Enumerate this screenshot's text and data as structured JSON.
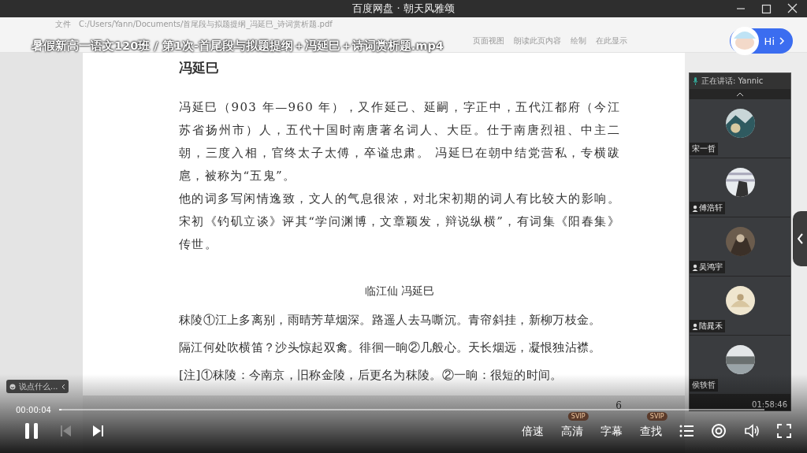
{
  "window": {
    "title": "百度网盘 · 朝天风雅颂"
  },
  "viewer": {
    "menu": "文件",
    "path": "C:/Users/Yann/Documents/首尾段与拟题提纲_冯延巳_诗词赏析题.pdf",
    "toolbar": [
      "页面视图",
      "朗读此页内容",
      "绘制",
      "在此显示"
    ]
  },
  "video_title": "暑假新高一语文120班 / 第1次-首尾段与拟题提纲＋冯延巳＋诗词赏析题.mp4",
  "assistant": {
    "label": "Hi"
  },
  "document": {
    "heading": "冯延巳",
    "paragraphs": [
      "冯延巳（903 年—960 年），又作延己、延嗣，字正中，五代江都府（今江苏省扬州市）人，五代十国时南唐著名词人、大臣。仕于南唐烈祖、中主二朝，三度入相，官终太子太傅，卒谥忠肃。 冯延巳在朝中结党营私，专横跋扈，被称为“五鬼”。",
      "他的词多写闲情逸致，文人的气息很浓，对北宋初期的词人有比较大的影响。宋初《钓矶立谈》评其“学问渊博，文章颖发，辩说纵横”，有词集《阳春集》传世。"
    ],
    "poem_title": "临江仙  冯延巳",
    "poem_lines": [
      "秣陵①江上多离别，雨晴芳草烟深。路遥人去马嘶沉。青帘斜挂，新柳万枝金。",
      "隔江何处吹横笛？沙头惊起双禽。徘徊一晌②几般心。天长烟远，凝恨独沾襟。"
    ],
    "note": "[注]①秣陵：今南京，旧称金陵，后更名为秣陵。②一晌：很短的时间。",
    "page_number": "6"
  },
  "meeting": {
    "speaking": "正在讲话: Yannic",
    "participants": [
      {
        "name": "宋一哲",
        "muted": false
      },
      {
        "name": "傅浩轩",
        "muted": true
      },
      {
        "name": "吴鸿宇",
        "muted": true
      },
      {
        "name": "陆晁禾",
        "muted": true
      },
      {
        "name": "侯轶哲",
        "muted": false
      }
    ],
    "duration": "01:58:46"
  },
  "player": {
    "chat_placeholder": "说点什么...",
    "current_time": "00:00:04",
    "progress": {
      "level": 0.003
    },
    "playing": true,
    "controls": [
      {
        "label": "倍速"
      },
      {
        "label": "高清",
        "badge": "SVIP"
      },
      {
        "label": "字幕"
      },
      {
        "label": "查找",
        "badge": "SVIP"
      }
    ]
  }
}
